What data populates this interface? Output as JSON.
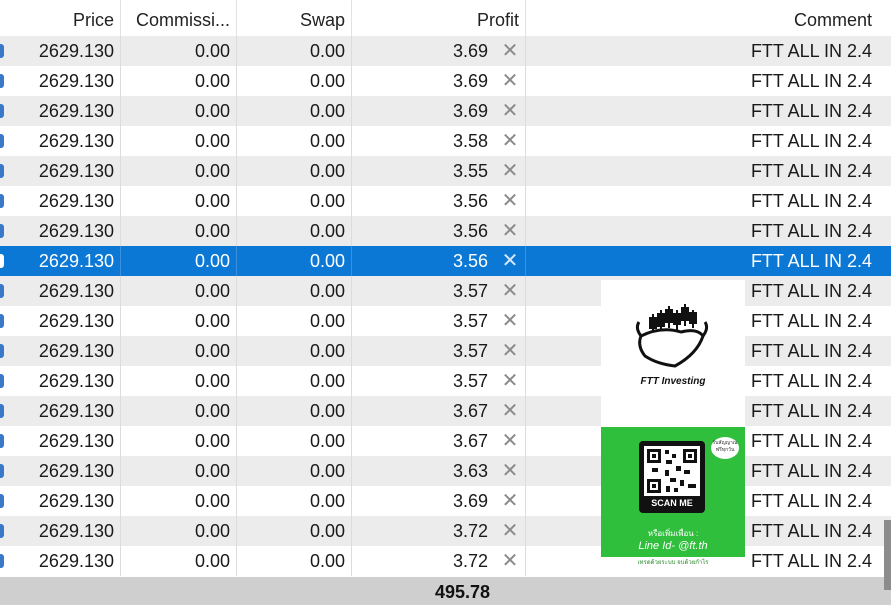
{
  "columns": {
    "price": "Price",
    "commission": "Commissi...",
    "swap": "Swap",
    "profit": "Profit",
    "comment": "Comment"
  },
  "rows": [
    {
      "price": "2629.130",
      "commission": "0.00",
      "swap": "0.00",
      "profit": "3.69",
      "comment": "FTT ALL IN 2.4"
    },
    {
      "price": "2629.130",
      "commission": "0.00",
      "swap": "0.00",
      "profit": "3.69",
      "comment": "FTT ALL IN 2.4"
    },
    {
      "price": "2629.130",
      "commission": "0.00",
      "swap": "0.00",
      "profit": "3.69",
      "comment": "FTT ALL IN 2.4"
    },
    {
      "price": "2629.130",
      "commission": "0.00",
      "swap": "0.00",
      "profit": "3.58",
      "comment": "FTT ALL IN 2.4"
    },
    {
      "price": "2629.130",
      "commission": "0.00",
      "swap": "0.00",
      "profit": "3.55",
      "comment": "FTT ALL IN 2.4"
    },
    {
      "price": "2629.130",
      "commission": "0.00",
      "swap": "0.00",
      "profit": "3.56",
      "comment": "FTT ALL IN 2.4"
    },
    {
      "price": "2629.130",
      "commission": "0.00",
      "swap": "0.00",
      "profit": "3.56",
      "comment": "FTT ALL IN 2.4"
    },
    {
      "price": "2629.130",
      "commission": "0.00",
      "swap": "0.00",
      "profit": "3.56",
      "comment": "FTT ALL IN 2.4",
      "selected": true
    },
    {
      "price": "2629.130",
      "commission": "0.00",
      "swap": "0.00",
      "profit": "3.57",
      "comment": "FTT ALL IN 2.4"
    },
    {
      "price": "2629.130",
      "commission": "0.00",
      "swap": "0.00",
      "profit": "3.57",
      "comment": "FTT ALL IN 2.4"
    },
    {
      "price": "2629.130",
      "commission": "0.00",
      "swap": "0.00",
      "profit": "3.57",
      "comment": "FTT ALL IN 2.4"
    },
    {
      "price": "2629.130",
      "commission": "0.00",
      "swap": "0.00",
      "profit": "3.57",
      "comment": "FTT ALL IN 2.4"
    },
    {
      "price": "2629.130",
      "commission": "0.00",
      "swap": "0.00",
      "profit": "3.67",
      "comment": "FTT ALL IN 2.4"
    },
    {
      "price": "2629.130",
      "commission": "0.00",
      "swap": "0.00",
      "profit": "3.67",
      "comment": "FTT ALL IN 2.4"
    },
    {
      "price": "2629.130",
      "commission": "0.00",
      "swap": "0.00",
      "profit": "3.63",
      "comment": "FTT ALL IN 2.4"
    },
    {
      "price": "2629.130",
      "commission": "0.00",
      "swap": "0.00",
      "profit": "3.69",
      "comment": "FTT ALL IN 2.4"
    },
    {
      "price": "2629.130",
      "commission": "0.00",
      "swap": "0.00",
      "profit": "3.72",
      "comment": "FTT ALL IN 2.4"
    },
    {
      "price": "2629.130",
      "commission": "0.00",
      "swap": "0.00",
      "profit": "3.72",
      "comment": "FTT ALL IN 2.4"
    }
  ],
  "footer": {
    "total_profit": "495.78"
  },
  "close_icon": "close-icon",
  "colors": {
    "selection": "#0a78d4",
    "alt_row": "#ececec",
    "footer": "#cfcfcf",
    "ad_green": "#2fbf3c"
  },
  "ad": {
    "brand": "FTT Investing",
    "bubble": "รับสัญญาณ ฟรีทุกวัน",
    "scan": "SCAN ME",
    "line1": "หรือเพิ่มเพื่อน :",
    "line2": "Line Id- @ft.th",
    "bottom": "เทรดด้วยระบบ จบด้วยกำไร"
  }
}
